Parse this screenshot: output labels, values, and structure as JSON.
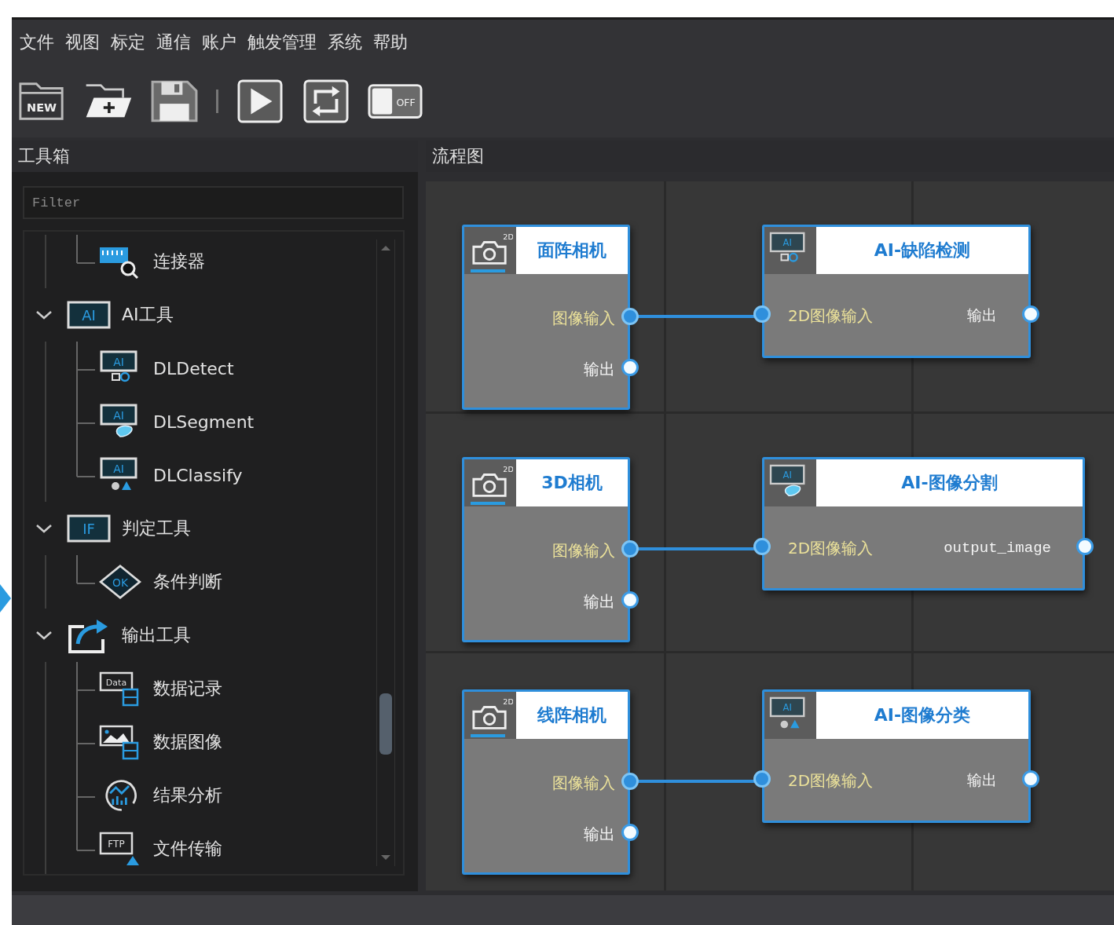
{
  "menu": [
    "文件",
    "视图",
    "标定",
    "通信",
    "账户",
    "触发管理",
    "系统",
    "帮助"
  ],
  "toolbar": [
    {
      "kind": "new",
      "text": "NEW"
    },
    {
      "kind": "open"
    },
    {
      "kind": "save"
    },
    {
      "kind": "separator"
    },
    {
      "kind": "run"
    },
    {
      "kind": "loop"
    },
    {
      "kind": "switch",
      "text": "OFF",
      "on": false
    }
  ],
  "toolbox": {
    "title": "工具箱",
    "filter": {
      "placeholder": "Filter"
    },
    "tree": [
      {
        "children": [
          {
            "label": "连接器",
            "kind": "connector"
          }
        ]
      },
      {
        "label": "AI工具",
        "kind": "ai",
        "badge": "AI",
        "expanded": true,
        "children": [
          {
            "label": "DLDetect",
            "kind": "ai-detect",
            "badge": "AI"
          },
          {
            "label": "DLSegment",
            "kind": "ai-segment",
            "badge": "AI"
          },
          {
            "label": "DLClassify",
            "kind": "ai-classify",
            "badge": "AI"
          }
        ]
      },
      {
        "label": "判定工具",
        "kind": "if",
        "badge": "IF",
        "expanded": true,
        "children": [
          {
            "label": "条件判断",
            "kind": "ok",
            "badge": "OK"
          }
        ]
      },
      {
        "label": "输出工具",
        "kind": "export",
        "expanded": true,
        "children": [
          {
            "label": "数据记录",
            "kind": "data",
            "badge": "Data"
          },
          {
            "label": "数据图像",
            "kind": "image"
          },
          {
            "label": "结果分析",
            "kind": "analysis"
          },
          {
            "label": "文件传输",
            "kind": "ftp",
            "badge": "FTP"
          }
        ]
      }
    ]
  },
  "flowchart": {
    "title": "流程图",
    "links": [
      {
        "source": {
          "title": "面阵相机",
          "kind": "camera",
          "badge": "2D",
          "ports": [
            {
              "label": "图像输入",
              "kind": "input"
            },
            {
              "label": "输出",
              "kind": "output"
            }
          ]
        },
        "target": {
          "title": "AI-缺陷检测",
          "kind": "ai-detect",
          "badge": "AI",
          "input": "2D图像输入",
          "output": "输出"
        }
      },
      {
        "source": {
          "title": "3D相机",
          "kind": "camera",
          "badge": "2D",
          "ports": [
            {
              "label": "图像输入",
              "kind": "input"
            },
            {
              "label": "输出",
              "kind": "output"
            }
          ]
        },
        "target": {
          "title": "AI-图像分割",
          "kind": "ai-segment",
          "badge": "AI",
          "input": "2D图像输入",
          "output": "output_image"
        }
      },
      {
        "source": {
          "title": "线阵相机",
          "kind": "camera",
          "badge": "2D",
          "ports": [
            {
              "label": "图像输入",
              "kind": "input"
            },
            {
              "label": "输出",
              "kind": "output"
            }
          ]
        },
        "target": {
          "title": "AI-图像分类",
          "kind": "ai-classify",
          "badge": "AI",
          "input": "2D图像输入",
          "output": "输出"
        }
      }
    ]
  }
}
